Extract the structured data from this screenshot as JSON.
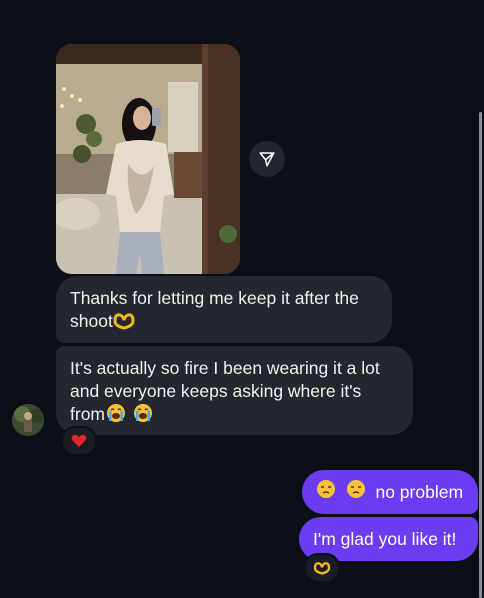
{
  "conversation": {
    "shared_photo": {
      "kind": "mirror-selfie-photo",
      "share_icon": "paper-plane-icon"
    },
    "messages": [
      {
        "id": "msg1",
        "direction": "incoming",
        "text": "Thanks for letting me keep it after the shoot",
        "trailing_emoji": [
          "heart-hands-emoji"
        ]
      },
      {
        "id": "msg2",
        "direction": "incoming",
        "line1": "It's actually so fire I been wearing it a lot",
        "line2": "and everyone keeps asking where it's",
        "line3": "from",
        "trailing_emoji": [
          "loudly-crying-face-emoji",
          "loudly-crying-face-emoji"
        ],
        "reaction": "red-heart-emoji"
      },
      {
        "id": "msg3",
        "direction": "outgoing",
        "leading_emoji": [
          "unamused-face-emoji",
          "unamused-face-emoji"
        ],
        "text": "no problem"
      },
      {
        "id": "msg4",
        "direction": "outgoing",
        "text": "I'm glad you like it!",
        "reaction": "heart-hands-emoji"
      }
    ],
    "colors": {
      "background": "#0c0f17",
      "incoming_bubble": "#25272f",
      "outgoing_bubble": "#6c3cf0",
      "text": "#f1f1f3"
    }
  }
}
